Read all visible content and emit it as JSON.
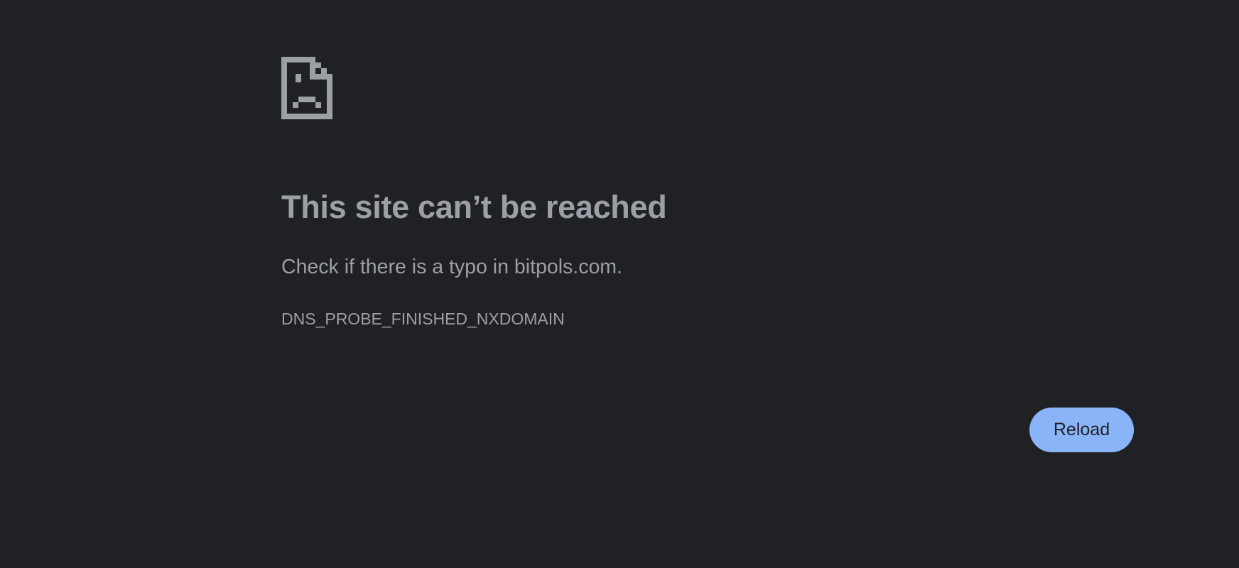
{
  "page": {
    "background_color": "#202124",
    "text_color": "#9aa0a6"
  },
  "error": {
    "icon": "sad-document-icon",
    "title": "This site can’t be reached",
    "suggestion": "Check if there is a typo in bitpols.com.",
    "code": "DNS_PROBE_FINISHED_NXDOMAIN"
  },
  "actions": {
    "reload_label": "Reload",
    "reload_color": "#8ab4f8"
  }
}
